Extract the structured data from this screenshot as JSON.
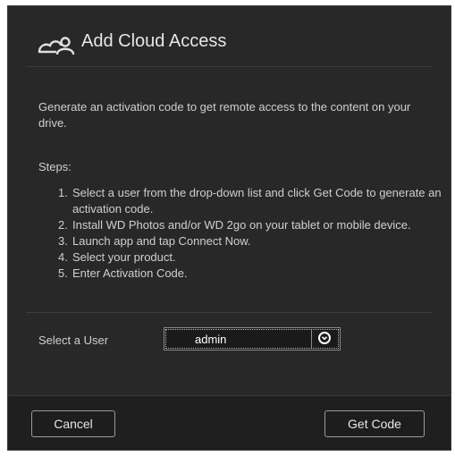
{
  "dialog": {
    "title": "Add Cloud Access",
    "title_icon": "cloud-user-icon",
    "description": "Generate an activation code to get remote access to the content on your drive.",
    "steps_label": "Steps:",
    "steps": [
      {
        "num": "1.",
        "text": "Select a user from the drop-down list and click Get Code to generate an activation code."
      },
      {
        "num": "2.",
        "text": "Install WD Photos and/or WD 2go on your tablet or mobile device."
      },
      {
        "num": "3.",
        "text": "Launch app and tap Connect Now."
      },
      {
        "num": "4.",
        "text": "Select your product."
      },
      {
        "num": "5.",
        "text": "Enter Activation Code."
      }
    ],
    "user_label": "Select a User",
    "user_select": {
      "value": "admin",
      "icon": "chevron-down-circle-icon"
    }
  },
  "footer": {
    "cancel_label": "Cancel",
    "get_code_label": "Get Code"
  },
  "colors": {
    "dialog_bg": "#282828",
    "footer_bg": "#1f1f1f",
    "text": "#d4d4d4"
  }
}
